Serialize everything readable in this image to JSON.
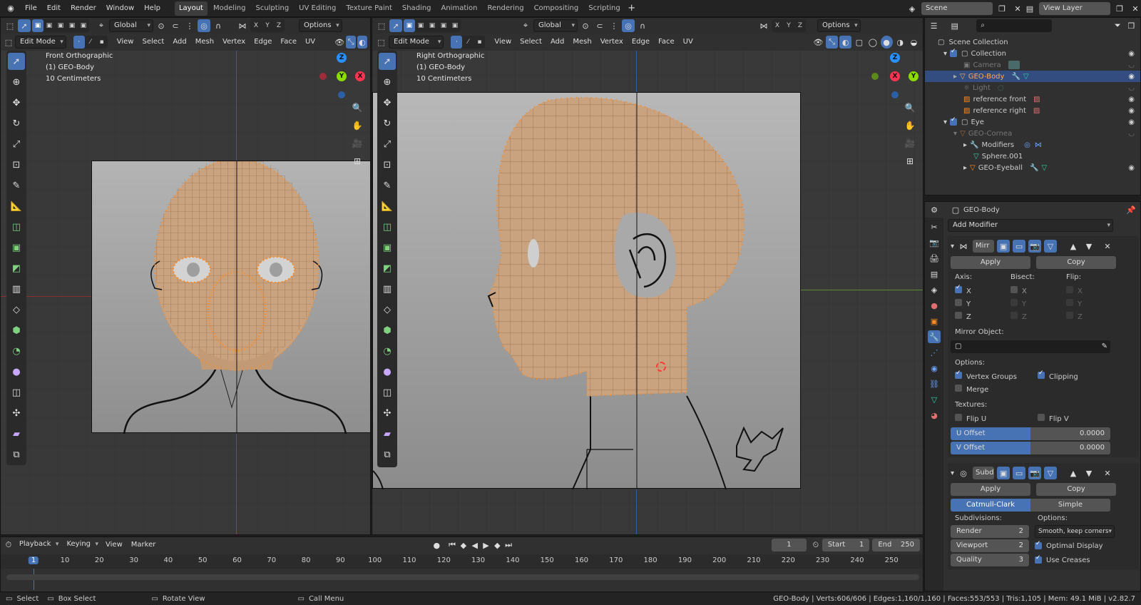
{
  "topbar": {
    "menus": [
      "File",
      "Edit",
      "Render",
      "Window",
      "Help"
    ],
    "workspaces": [
      "Layout",
      "Modeling",
      "Sculpting",
      "UV Editing",
      "Texture Paint",
      "Shading",
      "Animation",
      "Rendering",
      "Compositing",
      "Scripting"
    ],
    "active_workspace": "Layout",
    "scene": "Scene",
    "view_layer": "View Layer"
  },
  "viewport_left": {
    "mode": "Edit Mode",
    "menus": [
      "View",
      "Select",
      "Add",
      "Mesh",
      "Vertex",
      "Edge",
      "Face",
      "UV"
    ],
    "transform": "Global",
    "axes": [
      "X",
      "Y",
      "Z"
    ],
    "options": "Options",
    "view_name": "Front Orthographic",
    "object": "(1) GEO-Body",
    "scale": "10 Centimeters"
  },
  "viewport_right": {
    "mode": "Edit Mode",
    "menus": [
      "View",
      "Select",
      "Add",
      "Mesh",
      "Vertex",
      "Edge",
      "Face",
      "UV"
    ],
    "transform": "Global",
    "axes": [
      "X",
      "Y",
      "Z"
    ],
    "options": "Options",
    "view_name": "Right Orthographic",
    "object": "(1) GEO-Body",
    "scale": "10 Centimeters"
  },
  "gizmo_left": {
    "z": "Z",
    "y": "Y",
    "x": "X"
  },
  "gizmo_right": {
    "z": "Z",
    "x": "X",
    "y": "Y"
  },
  "outliner": {
    "root": "Scene Collection",
    "items": [
      {
        "label": "Collection",
        "indent": 1
      },
      {
        "label": "Camera",
        "indent": 2
      },
      {
        "label": "GEO-Body",
        "indent": 2
      },
      {
        "label": "Light",
        "indent": 2
      },
      {
        "label": "reference front",
        "indent": 2
      },
      {
        "label": "reference right",
        "indent": 2
      },
      {
        "label": "Eye",
        "indent": 1
      },
      {
        "label": "GEO-Cornea",
        "indent": 2
      },
      {
        "label": "Modifiers",
        "indent": 3
      },
      {
        "label": "Sphere.001",
        "indent": 3
      },
      {
        "label": "GEO-Eyeball",
        "indent": 3
      }
    ]
  },
  "properties": {
    "object_name": "GEO-Body",
    "add_modifier": "Add Modifier",
    "mirror": {
      "name": "Mirr",
      "apply": "Apply",
      "copy": "Copy",
      "axis_label": "Axis:",
      "bisect_label": "Bisect:",
      "flip_label": "Flip:",
      "axes": [
        "X",
        "Y",
        "Z"
      ],
      "mirror_object_label": "Mirror Object:",
      "options_label": "Options:",
      "vertex_groups": "Vertex Groups",
      "clipping": "Clipping",
      "merge": "Merge",
      "textures_label": "Textures:",
      "flip_u": "Flip U",
      "flip_v": "Flip V",
      "u_offset_label": "U Offset",
      "u_offset": "0.0000",
      "v_offset_label": "V Offset",
      "v_offset": "0.0000"
    },
    "subsurf": {
      "name": "Subd",
      "apply": "Apply",
      "copy": "Copy",
      "catmull": "Catmull-Clark",
      "simple": "Simple",
      "subdivisions_label": "Subdivisions:",
      "options_label": "Options:",
      "render_label": "Render",
      "render": "2",
      "viewport_label": "Viewport",
      "viewport": "2",
      "quality_label": "Quality",
      "quality": "3",
      "uv_smooth": "Smooth, keep corners",
      "optimal_display": "Optimal Display",
      "use_creases": "Use Creases"
    }
  },
  "timeline": {
    "menus": [
      "Playback",
      "Keying",
      "View",
      "Marker"
    ],
    "current_frame": "1",
    "start_label": "Start",
    "start": "1",
    "end_label": "End",
    "end": "250",
    "ticks": [
      "1",
      "10",
      "20",
      "30",
      "40",
      "50",
      "60",
      "70",
      "80",
      "90",
      "100",
      "110",
      "120",
      "130",
      "140",
      "150",
      "160",
      "170",
      "180",
      "190",
      "200",
      "210",
      "220",
      "230",
      "240",
      "250"
    ]
  },
  "status": {
    "select": "Select",
    "box_select": "Box Select",
    "rotate_view": "Rotate View",
    "call_menu": "Call Menu",
    "stats": "GEO-Body | Verts:606/606 | Edges:1,160/1,160 | Faces:553/553 | Tris:1,105 | Mem: 49.1 MiB | v2.82.7"
  },
  "colors": {
    "accent": "#4772b3",
    "vertex": "#ff8a1e",
    "skin": "#c9a27f",
    "axis_x": "#ff3352",
    "axis_y": "#8bdc00",
    "axis_z": "#2890ff"
  }
}
